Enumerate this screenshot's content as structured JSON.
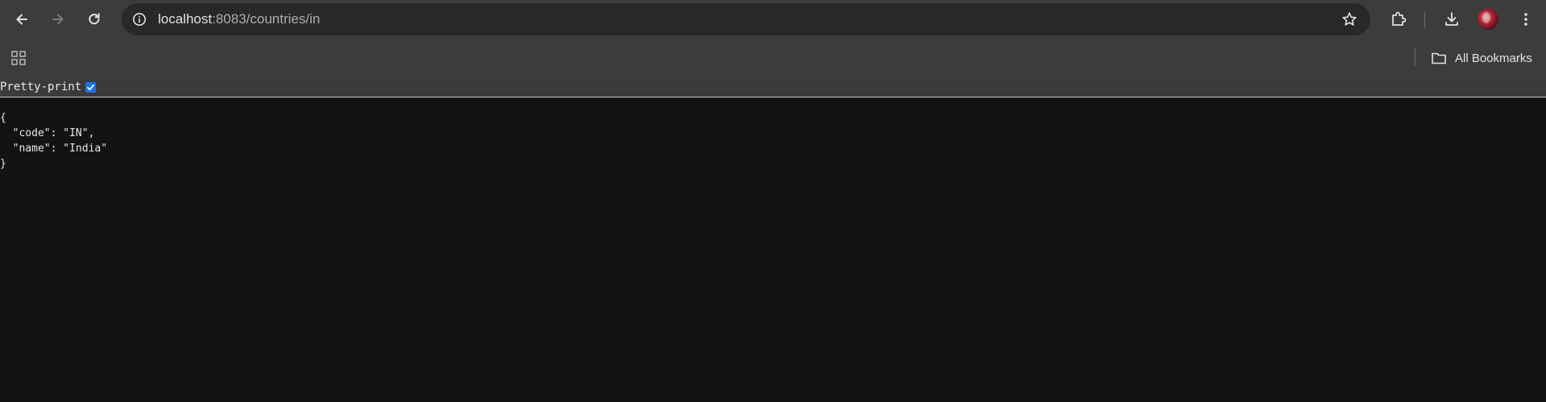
{
  "browser": {
    "url_host": "localhost",
    "url_rest": ":8083/countries/in",
    "icons": {
      "back": "arrow-left",
      "forward": "arrow-right",
      "reload": "reload",
      "site_info": "info-circle",
      "bookmark_star": "star-outline",
      "extensions": "puzzle-piece",
      "downloads": "download-arrow",
      "menu": "three-dots-vertical",
      "apps": "grid",
      "bookmarks_folder": "folder"
    }
  },
  "bookmarks_bar": {
    "all_bookmarks_label": "All Bookmarks"
  },
  "page": {
    "pretty_print_label": "Pretty-print",
    "pretty_print_checked": true,
    "json_lines": [
      "{",
      "  \"code\": \"IN\",",
      "  \"name\": \"India\"",
      "}"
    ]
  },
  "colors": {
    "toolbar_bg": "#3c3c3c",
    "omnibox_bg": "#282828",
    "page_bg": "#131313",
    "checkbox_accent": "#1a73e8"
  }
}
